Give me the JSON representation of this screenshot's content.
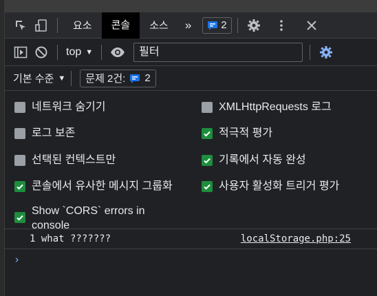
{
  "tabs": {
    "elements": "요소",
    "console": "콘솔",
    "sources": "소스",
    "more": "»",
    "issues_count": "2"
  },
  "toolbar": {
    "context": "top",
    "filter_placeholder": "필터"
  },
  "levels": {
    "label": "기본 수준",
    "issues_label": "문제 2건:",
    "issues_count": "2"
  },
  "settings": {
    "hide_network": {
      "label": "네트워크 숨기기",
      "checked": false
    },
    "preserve_log": {
      "label": "로그 보존",
      "checked": false
    },
    "selected_context": {
      "label": "선택된 컨텍스트만",
      "checked": false
    },
    "group_similar": {
      "label": "콘솔에서 유사한 메시지 그룹화",
      "checked": true
    },
    "cors_errors": {
      "label": "Show `CORS` errors in console",
      "checked": true
    },
    "xhr_log": {
      "label": "XMLHttpRequests 로그",
      "checked": false
    },
    "eager_eval": {
      "label": "적극적 평가",
      "checked": true
    },
    "autocomplete": {
      "label": "기록에서 자동 완성",
      "checked": true
    },
    "user_activation": {
      "label": "사용자 활성화 트리거 평가",
      "checked": true
    }
  },
  "log": {
    "message": "1 what ???????",
    "source": "localStorage.php:25"
  },
  "prompt": "›",
  "colors": {
    "background": "#202124",
    "checked": "#1e8e3e",
    "unchecked": "#9aa0a6",
    "accent": "#8ab4f8",
    "issue_badge": "#1a73e8"
  }
}
